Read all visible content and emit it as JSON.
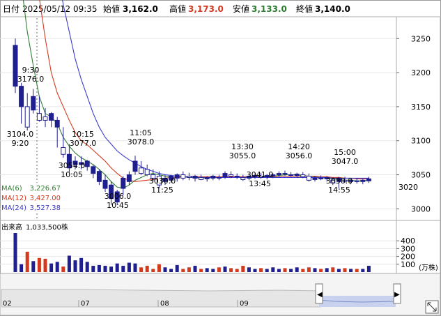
{
  "header": {
    "date_label": "日付",
    "date_value": "2025/05/12 09:35",
    "open_label": "始値",
    "open_value": "3,162.0",
    "high_label": "高値",
    "high_value": "3,173.0",
    "low_label": "安値",
    "low_value": "3,133.0",
    "close_label": "終値",
    "close_value": "3,140.0"
  },
  "colors": {
    "up": "#1f1f8f",
    "down": "#ffffff",
    "ma6": "#2e7d32",
    "ma12": "#d23a1f",
    "ma24": "#3a3acc",
    "high_text": "#d23a1f",
    "low_text": "#2e7d32",
    "current_price": "#d23a1f",
    "volume_up": "#1f1f8f",
    "volume_down": "#d23a1f"
  },
  "ma_legend": [
    {
      "label": "MA(6)",
      "value": "3,226.67"
    },
    {
      "label": "MA(12)",
      "value": "3,427.00"
    },
    {
      "label": "MA(24)",
      "value": "3,527.38"
    }
  ],
  "volume_legend": {
    "label": "出来高",
    "value": "1,033,500株"
  },
  "volume_unit": "(万株)",
  "current_price_label": "3020",
  "price_axis": {
    "ticks": [
      "3250",
      "3200",
      "3150",
      "3100",
      "3050",
      "3000"
    ],
    "min": 2985,
    "max": 3280
  },
  "volume_axis": {
    "ticks": [
      "400",
      "300",
      "200",
      "100"
    ],
    "min": 0,
    "max": 500
  },
  "navigator_dates": [
    "02",
    "07",
    "08",
    "09"
  ],
  "annotations": [
    {
      "time": "9:30",
      "price": "3176.0",
      "pos": "above"
    },
    {
      "time": "9:20",
      "price": "3104.0",
      "pos": "below"
    },
    {
      "time": "10:15",
      "price": "3077.0",
      "pos": "above"
    },
    {
      "time": "10:05",
      "price": "3054.0",
      "pos": "below"
    },
    {
      "time": "10:45",
      "price": "3006.0",
      "pos": "below"
    },
    {
      "time": "11:05",
      "price": "3078.0",
      "pos": "above"
    },
    {
      "time": "11:25",
      "price": "3030.0",
      "pos": "below"
    },
    {
      "time": "13:30",
      "price": "3055.0",
      "pos": "above"
    },
    {
      "time": "13:45",
      "price": "3041.0",
      "pos": "below"
    },
    {
      "time": "14:20",
      "price": "3056.0",
      "pos": "above"
    },
    {
      "time": "14:55",
      "price": "3030.0",
      "pos": "below"
    },
    {
      "time": "15:00",
      "price": "3047.0",
      "pos": "above"
    }
  ],
  "chart_data": {
    "type": "candlestick",
    "title": "",
    "candles": [
      {
        "o": 3180,
        "h": 3250,
        "l": 3170,
        "c": 3240,
        "v": 500
      },
      {
        "o": 3150,
        "h": 3185,
        "l": 3125,
        "c": 3180,
        "v": 100
      },
      {
        "o": 3150,
        "h": 3170,
        "l": 3115,
        "c": 3120,
        "v": 260
      },
      {
        "o": 3145,
        "h": 3176,
        "l": 3140,
        "c": 3165,
        "v": 140
      },
      {
        "o": 3140,
        "h": 3165,
        "l": 3128,
        "c": 3130,
        "v": 180
      },
      {
        "o": 3135,
        "h": 3148,
        "l": 3120,
        "c": 3130,
        "v": 170
      },
      {
        "o": 3130,
        "h": 3142,
        "l": 3120,
        "c": 3140,
        "v": 110
      },
      {
        "o": 3120,
        "h": 3135,
        "l": 3090,
        "c": 3130,
        "v": 130
      },
      {
        "o": 3090,
        "h": 3120,
        "l": 3075,
        "c": 3080,
        "v": 70
      },
      {
        "o": 3060,
        "h": 3095,
        "l": 3054,
        "c": 3080,
        "v": 210
      },
      {
        "o": 3065,
        "h": 3077,
        "l": 3058,
        "c": 3070,
        "v": 150
      },
      {
        "o": 3065,
        "h": 3077,
        "l": 3058,
        "c": 3068,
        "v": 180
      },
      {
        "o": 3062,
        "h": 3072,
        "l": 3056,
        "c": 3070,
        "v": 130
      },
      {
        "o": 3052,
        "h": 3065,
        "l": 3045,
        "c": 3062,
        "v": 80
      },
      {
        "o": 3040,
        "h": 3058,
        "l": 3035,
        "c": 3055,
        "v": 90
      },
      {
        "o": 3030,
        "h": 3050,
        "l": 3025,
        "c": 3042,
        "v": 80
      },
      {
        "o": 3015,
        "h": 3040,
        "l": 3006,
        "c": 3035,
        "v": 70
      },
      {
        "o": 3010,
        "h": 3028,
        "l": 3006,
        "c": 3025,
        "v": 110
      },
      {
        "o": 3030,
        "h": 3048,
        "l": 3020,
        "c": 3045,
        "v": 80
      },
      {
        "o": 3040,
        "h": 3055,
        "l": 3035,
        "c": 3050,
        "v": 120
      },
      {
        "o": 3055,
        "h": 3078,
        "l": 3050,
        "c": 3070,
        "v": 110
      },
      {
        "o": 3060,
        "h": 3070,
        "l": 3050,
        "c": 3052,
        "v": 60
      },
      {
        "o": 3058,
        "h": 3065,
        "l": 3048,
        "c": 3050,
        "v": 80
      },
      {
        "o": 3050,
        "h": 3058,
        "l": 3040,
        "c": 3045,
        "v": 40
      },
      {
        "o": 3048,
        "h": 3055,
        "l": 3030,
        "c": 3035,
        "v": 100
      },
      {
        "o": 3040,
        "h": 3050,
        "l": 3035,
        "c": 3045,
        "v": 60
      },
      {
        "o": 3042,
        "h": 3050,
        "l": 3038,
        "c": 3048,
        "v": 40
      },
      {
        "o": 3045,
        "h": 3052,
        "l": 3040,
        "c": 3050,
        "v": 90
      },
      {
        "o": 3050,
        "h": 3055,
        "l": 3042,
        "c": 3045,
        "v": 40
      },
      {
        "o": 3048,
        "h": 3053,
        "l": 3042,
        "c": 3046,
        "v": 60
      },
      {
        "o": 3045,
        "h": 3050,
        "l": 3040,
        "c": 3048,
        "v": 80
      },
      {
        "o": 3046,
        "h": 3050,
        "l": 3042,
        "c": 3043,
        "v": 40
      },
      {
        "o": 3044,
        "h": 3048,
        "l": 3040,
        "c": 3046,
        "v": 50
      },
      {
        "o": 3045,
        "h": 3050,
        "l": 3042,
        "c": 3048,
        "v": 40
      },
      {
        "o": 3046,
        "h": 3050,
        "l": 3042,
        "c": 3045,
        "v": 60
      },
      {
        "o": 3047,
        "h": 3055,
        "l": 3044,
        "c": 3052,
        "v": 70
      },
      {
        "o": 3050,
        "h": 3055,
        "l": 3045,
        "c": 3048,
        "v": 50
      },
      {
        "o": 3048,
        "h": 3052,
        "l": 3044,
        "c": 3047,
        "v": 40
      },
      {
        "o": 3046,
        "h": 3050,
        "l": 3041,
        "c": 3043,
        "v": 80
      },
      {
        "o": 3045,
        "h": 3050,
        "l": 3042,
        "c": 3048,
        "v": 60
      },
      {
        "o": 3047,
        "h": 3052,
        "l": 3044,
        "c": 3049,
        "v": 40
      },
      {
        "o": 3048,
        "h": 3053,
        "l": 3044,
        "c": 3046,
        "v": 50
      },
      {
        "o": 3047,
        "h": 3051,
        "l": 3043,
        "c": 3049,
        "v": 40
      },
      {
        "o": 3048,
        "h": 3052,
        "l": 3045,
        "c": 3050,
        "v": 60
      },
      {
        "o": 3050,
        "h": 3055,
        "l": 3046,
        "c": 3052,
        "v": 40
      },
      {
        "o": 3052,
        "h": 3056,
        "l": 3048,
        "c": 3051,
        "v": 50
      },
      {
        "o": 3050,
        "h": 3054,
        "l": 3047,
        "c": 3050,
        "v": 40
      },
      {
        "o": 3049,
        "h": 3053,
        "l": 3046,
        "c": 3051,
        "v": 60
      },
      {
        "o": 3050,
        "h": 3054,
        "l": 3045,
        "c": 3047,
        "v": 40
      },
      {
        "o": 3048,
        "h": 3052,
        "l": 3040,
        "c": 3042,
        "v": 60
      },
      {
        "o": 3043,
        "h": 3048,
        "l": 3040,
        "c": 3045,
        "v": 50
      },
      {
        "o": 3045,
        "h": 3049,
        "l": 3042,
        "c": 3044,
        "v": 40
      },
      {
        "o": 3044,
        "h": 3048,
        "l": 3040,
        "c": 3046,
        "v": 50
      },
      {
        "o": 3042,
        "h": 3046,
        "l": 3035,
        "c": 3038,
        "v": 60
      },
      {
        "o": 3040,
        "h": 3047,
        "l": 3030,
        "c": 3045,
        "v": 40
      },
      {
        "o": 3042,
        "h": 3047,
        "l": 3038,
        "c": 3040,
        "v": 50
      },
      {
        "o": 3040,
        "h": 3044,
        "l": 3036,
        "c": 3042,
        "v": 40
      },
      {
        "o": 3041,
        "h": 3045,
        "l": 3037,
        "c": 3040,
        "v": 40
      },
      {
        "o": 3040,
        "h": 3044,
        "l": 3036,
        "c": 3042,
        "v": 40
      },
      {
        "o": 3041,
        "h": 3047,
        "l": 3038,
        "c": 3044,
        "v": 80
      }
    ],
    "ma6": [
      3400,
      3330,
      3260,
      3210,
      3165,
      3140,
      3135,
      3125,
      3105,
      3092,
      3082,
      3075,
      3070,
      3065,
      3058,
      3050,
      3040,
      3032,
      3030,
      3035,
      3042,
      3046,
      3050,
      3052,
      3050,
      3048,
      3046,
      3046,
      3047,
      3046,
      3046,
      3045,
      3046,
      3046,
      3046,
      3047,
      3047,
      3047,
      3047,
      3047,
      3047,
      3047,
      3048,
      3048,
      3049,
      3050,
      3050,
      3050,
      3049,
      3048,
      3047,
      3046,
      3045,
      3044,
      3043,
      3042,
      3042,
      3041,
      3041,
      3042
    ],
    "ma12": [
      3600,
      3520,
      3450,
      3380,
      3310,
      3250,
      3200,
      3170,
      3150,
      3130,
      3112,
      3100,
      3094,
      3086,
      3078,
      3070,
      3060,
      3052,
      3045,
      3042,
      3040,
      3041,
      3042,
      3043,
      3044,
      3045,
      3046,
      3046,
      3047,
      3047,
      3047,
      3047,
      3047,
      3047,
      3047,
      3047,
      3047,
      3047,
      3047,
      3047,
      3047,
      3047,
      3047,
      3047,
      3048,
      3048,
      3048,
      3048,
      3048,
      3048,
      3048,
      3047,
      3047,
      3046,
      3046,
      3045,
      3045,
      3044,
      3044,
      3044
    ],
    "ma24": [
      3700,
      3650,
      3600,
      3550,
      3500,
      3450,
      3400,
      3350,
      3300,
      3260,
      3220,
      3190,
      3165,
      3140,
      3120,
      3105,
      3095,
      3085,
      3078,
      3072,
      3067,
      3062,
      3058,
      3055,
      3052,
      3050,
      3049,
      3048,
      3047,
      3047,
      3046,
      3046,
      3046,
      3046,
      3046,
      3046,
      3046,
      3046,
      3046,
      3046,
      3046,
      3046,
      3046,
      3046,
      3046,
      3046,
      3046,
      3046,
      3046,
      3046,
      3046,
      3046,
      3046,
      3045,
      3045,
      3045,
      3045,
      3045,
      3045,
      3045
    ]
  }
}
